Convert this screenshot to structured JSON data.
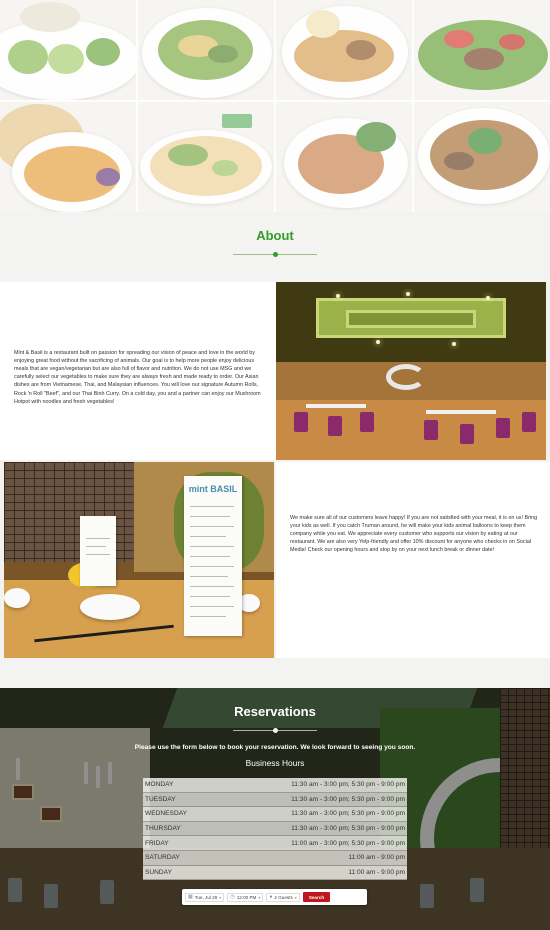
{
  "gallery": {
    "tiles": [
      {
        "icon": "spring-rolls-photo"
      },
      {
        "icon": "salad-photo"
      },
      {
        "icon": "noodle-dish-photo"
      },
      {
        "icon": "beef-salad-photo"
      },
      {
        "icon": "roti-curry-photo"
      },
      {
        "icon": "pizza-photo"
      },
      {
        "icon": "fried-rice-photo"
      },
      {
        "icon": "mushroom-soup-photo"
      }
    ]
  },
  "about": {
    "title": "About",
    "paragraph_1": "Mint & Basil is a restaurant built on passion for spreading our vision of peace and love in the world by enjoying great food without the sacrificing of animals. Our goal is to help more people enjoy delicious meals that are vegan/vegetarian but are also full of flavor and nutrition. We do not use MSG and we carefully select our vegetables to make sure they are always fresh and made ready to order. Our Asian dishes are from Vietnamese, Thai, and Malaysian influences. You will love our signature Autumn Rolls, Rock 'n Roll \"Beef\", and our Thai Binh Curry. On a cold day, you and a partner can enjoy our Mushroom Hotpot with noodles and fresh vegetables!",
    "paragraph_2": "We make sure all of our customers leave happy! If you are not satisfied with your meal, it is on us! Bring your kids as well. If you catch Truman around, he will make your kids animal balloons to keep them company while you eat. We appreciate every customer who supports our vision by eating at our restaurant. We are also very Yelp-friendly and offer 10% discount for anyone who checks in on Social Media! Check our opening hours and stop by on your next lunch break or dinner date!",
    "menu_brand": "mint BASIL"
  },
  "reservations": {
    "title": "Reservations",
    "intro": "Please use the form below to book your reservation. We look forward to seeing you soon.",
    "hours_title": "Business Hours",
    "hours": [
      {
        "day": "MONDAY",
        "time": "11:30 am - 3:00 pm; 5:30 pm - 9:00 pm"
      },
      {
        "day": "TUESDAY",
        "time": "11:30 am - 3:00 pm; 5:30 pm - 9:00 pm"
      },
      {
        "day": "WEDNESDAY",
        "time": "11:30 am - 3:00 pm; 5:30 pm - 9:00 pm"
      },
      {
        "day": "THURSDAY",
        "time": "11:30 am - 3:00 pm; 5:30 pm - 9:00 pm"
      },
      {
        "day": "FRIDAY",
        "time": "11:00 am - 3:00 pm; 5:30 pm - 9:00 pm"
      },
      {
        "day": "SATURDAY",
        "time": "11:00 am - 9:00 pm"
      },
      {
        "day": "SUNDAY",
        "time": "11:00 am - 9:00 pm"
      }
    ],
    "form": {
      "date_value": "Tue, Jul 28",
      "time_value": "12:00 PM",
      "guests_value": "2 Guests",
      "search_label": "Search",
      "accent": "#c0161e"
    }
  }
}
